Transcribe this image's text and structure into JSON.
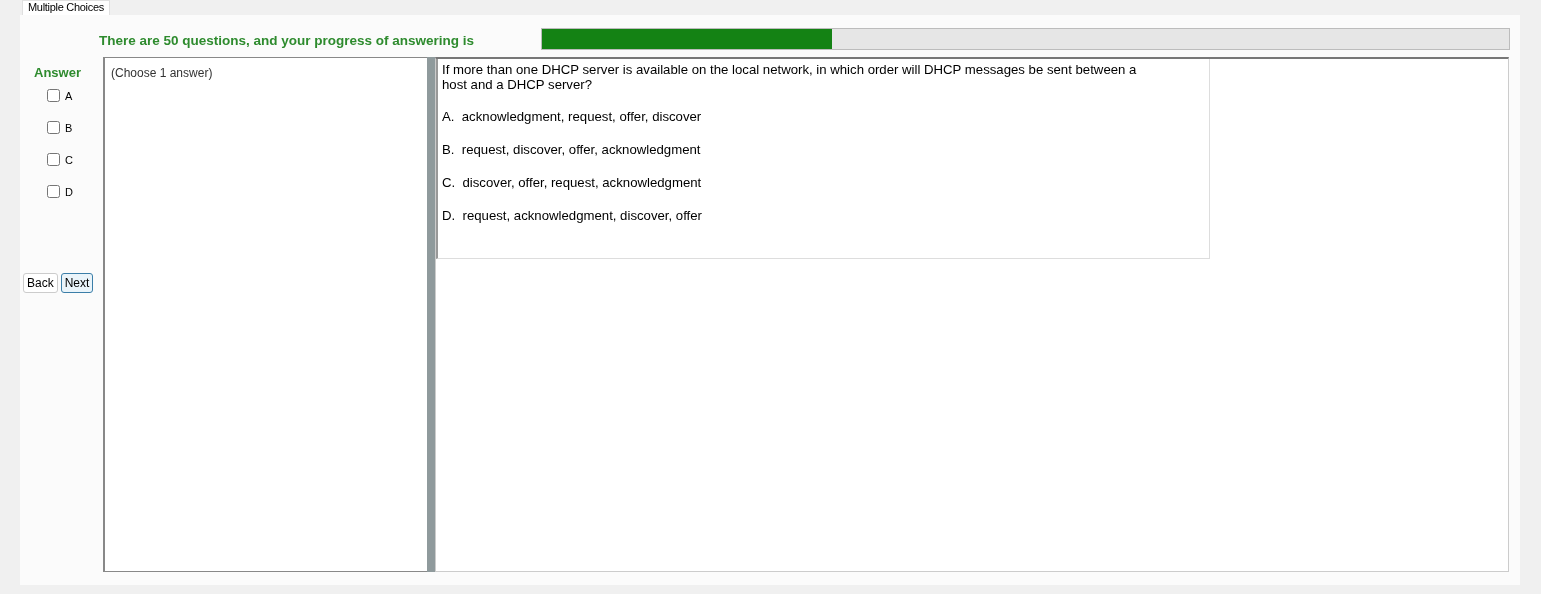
{
  "tabs": [
    {
      "label": "Multiple Choices",
      "selected": true
    }
  ],
  "progress": {
    "label": "There are 50 questions, and your progress of answering is",
    "level": 0.3
  },
  "answer": {
    "heading": "Answer",
    "choices": [
      {
        "label": "A",
        "checked": false
      },
      {
        "label": "B",
        "checked": false
      },
      {
        "label": "C",
        "checked": false
      },
      {
        "label": "D",
        "checked": false
      }
    ]
  },
  "buttons": [
    {
      "label": "Back",
      "focused": false
    },
    {
      "label": "Next",
      "focused": true
    }
  ],
  "instruction": "(Choose 1 answer)",
  "question": {
    "text": "If more than one DHCP server is available on the local network, in which order will DHCP messages be sent between a host and a DHCP server?",
    "options": [
      {
        "letter": "A.",
        "text": "acknowledgment, request, offer, discover"
      },
      {
        "letter": "B.",
        "text": "request, discover, offer, acknowledgment"
      },
      {
        "letter": "C.",
        "text": "discover, offer, request, acknowledgment"
      },
      {
        "letter": "D.",
        "text": "request, acknowledgment, discover, offer"
      }
    ]
  }
}
